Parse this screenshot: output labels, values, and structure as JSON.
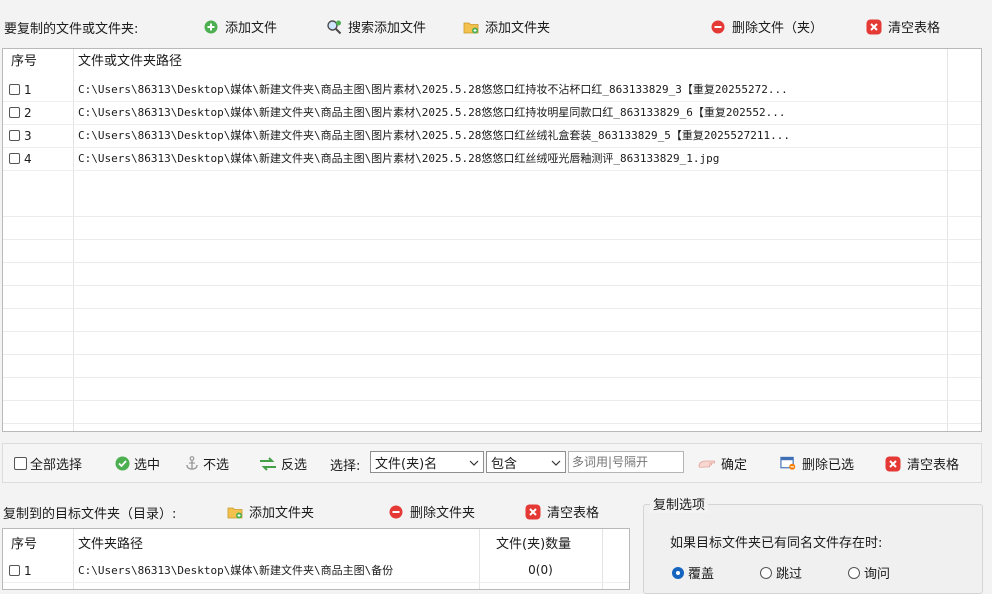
{
  "top_toolbar": {
    "section_label": "要复制的文件或文件夹:",
    "add_file": "添加文件",
    "search_add_file": "搜索添加文件",
    "add_folder": "添加文件夹",
    "delete_file": "删除文件（夹）",
    "clear_table": "清空表格"
  },
  "file_table": {
    "col_no": "序号",
    "col_path": "文件或文件夹路径",
    "rows": [
      {
        "no": "1",
        "path": "C:\\Users\\86313\\Desktop\\媒体\\新建文件夹\\商品主图\\图片素材\\2025.5.28悠悠口红持妆不沾杯口红_863133829_3【重复20255272..."
      },
      {
        "no": "2",
        "path": "C:\\Users\\86313\\Desktop\\媒体\\新建文件夹\\商品主图\\图片素材\\2025.5.28悠悠口红持妆明星同款口红_863133829_6【重复202552..."
      },
      {
        "no": "3",
        "path": "C:\\Users\\86313\\Desktop\\媒体\\新建文件夹\\商品主图\\图片素材\\2025.5.28悠悠口红丝绒礼盒套装_863133829_5【重复2025527211..."
      },
      {
        "no": "4",
        "path": "C:\\Users\\86313\\Desktop\\媒体\\新建文件夹\\商品主图\\图片素材\\2025.5.28悠悠口红丝绒哑光唇釉测评_863133829_1.jpg"
      }
    ]
  },
  "select_bar": {
    "select_all": "全部选择",
    "check": "选中",
    "uncheck": "不选",
    "invert": "反选",
    "select_label": "选择:",
    "field_select": "文件(夹)名",
    "match_select": "包含",
    "keyword_placeholder": "多词用|号隔开",
    "confirm": "确定",
    "delete_selected": "删除已选",
    "clear_table": "清空表格"
  },
  "target_toolbar": {
    "section_label": "复制到的目标文件夹（目录）:",
    "add_folder": "添加文件夹",
    "delete_folder": "删除文件夹",
    "clear_table": "清空表格"
  },
  "target_table": {
    "col_no": "序号",
    "col_path": "文件夹路径",
    "col_count": "文件(夹)数量",
    "rows": [
      {
        "no": "1",
        "path": "C:\\Users\\86313\\Desktop\\媒体\\新建文件夹\\商品主图\\备份",
        "count": "0(0)"
      }
    ]
  },
  "copy_options": {
    "title": "复制选项",
    "question": "如果目标文件夹已有同名文件存在时:",
    "options": [
      "覆盖",
      "跳过",
      "询问"
    ],
    "selected": "覆盖"
  },
  "colors": {
    "add_green": "#4caf50",
    "delete_red": "#e53935",
    "folder_yellow": "#f2c14e",
    "radio_blue": "#1565c0"
  }
}
